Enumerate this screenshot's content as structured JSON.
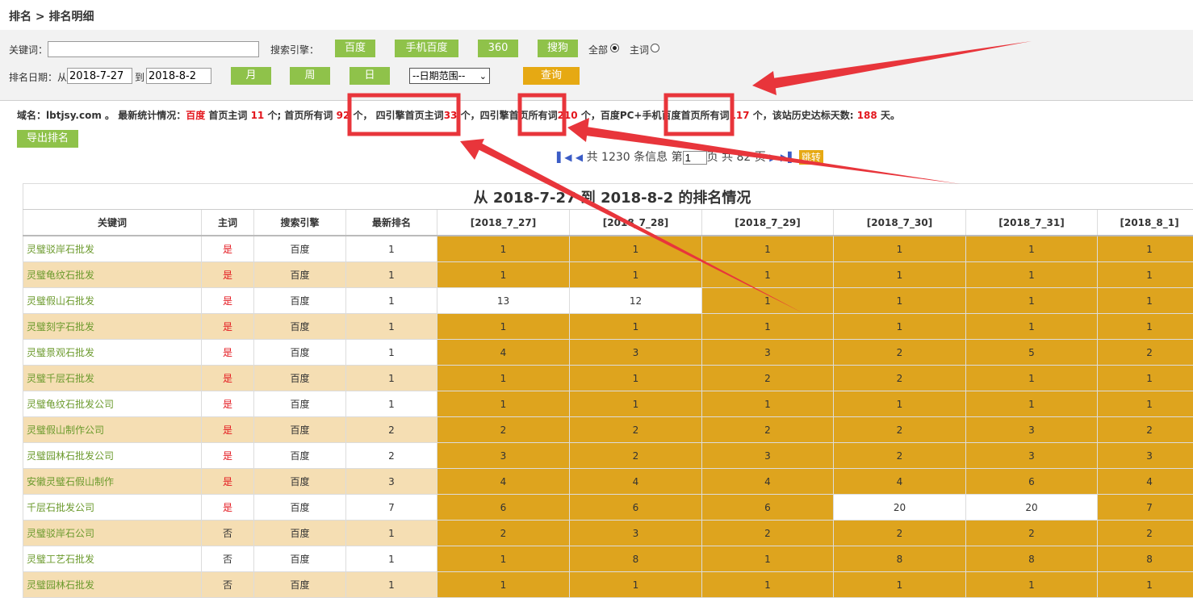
{
  "breadcrumb": "排名 > 排名明细",
  "filters": {
    "keyword_label": "关键词：",
    "keyword_value": "",
    "engine_label": "搜索引擎：",
    "engines": [
      "百度",
      "手机百度",
      "360",
      "搜狗"
    ],
    "scope_all": "全部",
    "scope_main": "主词",
    "date_label": "排名日期：从",
    "date_from": "2018-7-27",
    "date_to_label": "到",
    "date_to": "2018-8-2",
    "period_buttons": [
      "月",
      "周",
      "日"
    ],
    "range_select": "--日期范围--",
    "query_button": "查询"
  },
  "stats": {
    "t1": "域名：lbtjsy.com 。 最新统计情况：",
    "t2": "百度",
    "t3": " 首页主词 ",
    "v1": "11",
    "t4": " 个; 首页所有词 ",
    "v2": "92",
    "t5": " 个， 四引擎首页主词",
    "v3": "33",
    "t6": " 个，四引擎首页所有词",
    "v4": "210",
    "t7": " 个，百度PC+手机百度首页所有词",
    "v5": "117",
    "t8": " 个，该站历史达标天数: ",
    "v6": "188",
    "t9": " 天。"
  },
  "export_button": "导出排名",
  "pager": {
    "first_icon": "first-page-icon",
    "prev_icon": "prev-page-icon",
    "text_before": "共 1230 条信息 第",
    "page_value": "1",
    "text_after": "页 共 82 页",
    "jump_label": "跳转"
  },
  "table": {
    "title": "从 2018-7-27 到 2018-8-2 的排名情况",
    "headers": [
      "关键词",
      "主词",
      "搜索引擎",
      "最新排名",
      "[2018_7_27]",
      "[2018_7_28]",
      "[2018_7_29]",
      "[2018_7_30]",
      "[2018_7_31]",
      "[2018_8_1]"
    ],
    "rows": [
      {
        "kw": "灵璧驳岸石批发",
        "main": "是",
        "engine": "百度",
        "latest": "1",
        "days": [
          "1",
          "1",
          "1",
          "1",
          "1",
          "1"
        ]
      },
      {
        "kw": "灵璧龟纹石批发",
        "main": "是",
        "engine": "百度",
        "latest": "1",
        "days": [
          "1",
          "1",
          "1",
          "1",
          "1",
          "1"
        ]
      },
      {
        "kw": "灵璧假山石批发",
        "main": "是",
        "engine": "百度",
        "latest": "1",
        "days": [
          "13",
          "12",
          "1",
          "1",
          "1",
          "1"
        ]
      },
      {
        "kw": "灵璧刻字石批发",
        "main": "是",
        "engine": "百度",
        "latest": "1",
        "days": [
          "1",
          "1",
          "1",
          "1",
          "1",
          "1"
        ]
      },
      {
        "kw": "灵璧景观石批发",
        "main": "是",
        "engine": "百度",
        "latest": "1",
        "days": [
          "4",
          "3",
          "3",
          "2",
          "5",
          "2"
        ]
      },
      {
        "kw": "灵璧千层石批发",
        "main": "是",
        "engine": "百度",
        "latest": "1",
        "days": [
          "1",
          "1",
          "2",
          "2",
          "1",
          "1"
        ]
      },
      {
        "kw": "灵璧龟纹石批发公司",
        "main": "是",
        "engine": "百度",
        "latest": "1",
        "days": [
          "1",
          "1",
          "1",
          "1",
          "1",
          "1"
        ]
      },
      {
        "kw": "灵璧假山制作公司",
        "main": "是",
        "engine": "百度",
        "latest": "2",
        "days": [
          "2",
          "2",
          "2",
          "2",
          "3",
          "2"
        ]
      },
      {
        "kw": "灵璧园林石批发公司",
        "main": "是",
        "engine": "百度",
        "latest": "2",
        "days": [
          "3",
          "2",
          "3",
          "2",
          "3",
          "3"
        ]
      },
      {
        "kw": "安徽灵璧石假山制作",
        "main": "是",
        "engine": "百度",
        "latest": "3",
        "days": [
          "4",
          "4",
          "4",
          "4",
          "6",
          "4"
        ]
      },
      {
        "kw": "千层石批发公司",
        "main": "是",
        "engine": "百度",
        "latest": "7",
        "days": [
          "6",
          "6",
          "6",
          "20",
          "20",
          "7"
        ]
      },
      {
        "kw": "灵璧驳岸石公司",
        "main": "否",
        "engine": "百度",
        "latest": "1",
        "days": [
          "2",
          "3",
          "2",
          "2",
          "2",
          "2"
        ]
      },
      {
        "kw": "灵璧工艺石批发",
        "main": "否",
        "engine": "百度",
        "latest": "1",
        "days": [
          "1",
          "8",
          "1",
          "8",
          "8",
          "8"
        ]
      },
      {
        "kw": "灵璧园林石批发",
        "main": "否",
        "engine": "百度",
        "latest": "1",
        "days": [
          "1",
          "1",
          "1",
          "1",
          "1",
          "1"
        ]
      }
    ]
  },
  "colors": {
    "green_button": "#8fc24a",
    "orange_button": "#e6a913",
    "top_rank_cell": "#dea41e",
    "even_row": "#f5deb3",
    "annotation_red": "#e8353b"
  }
}
